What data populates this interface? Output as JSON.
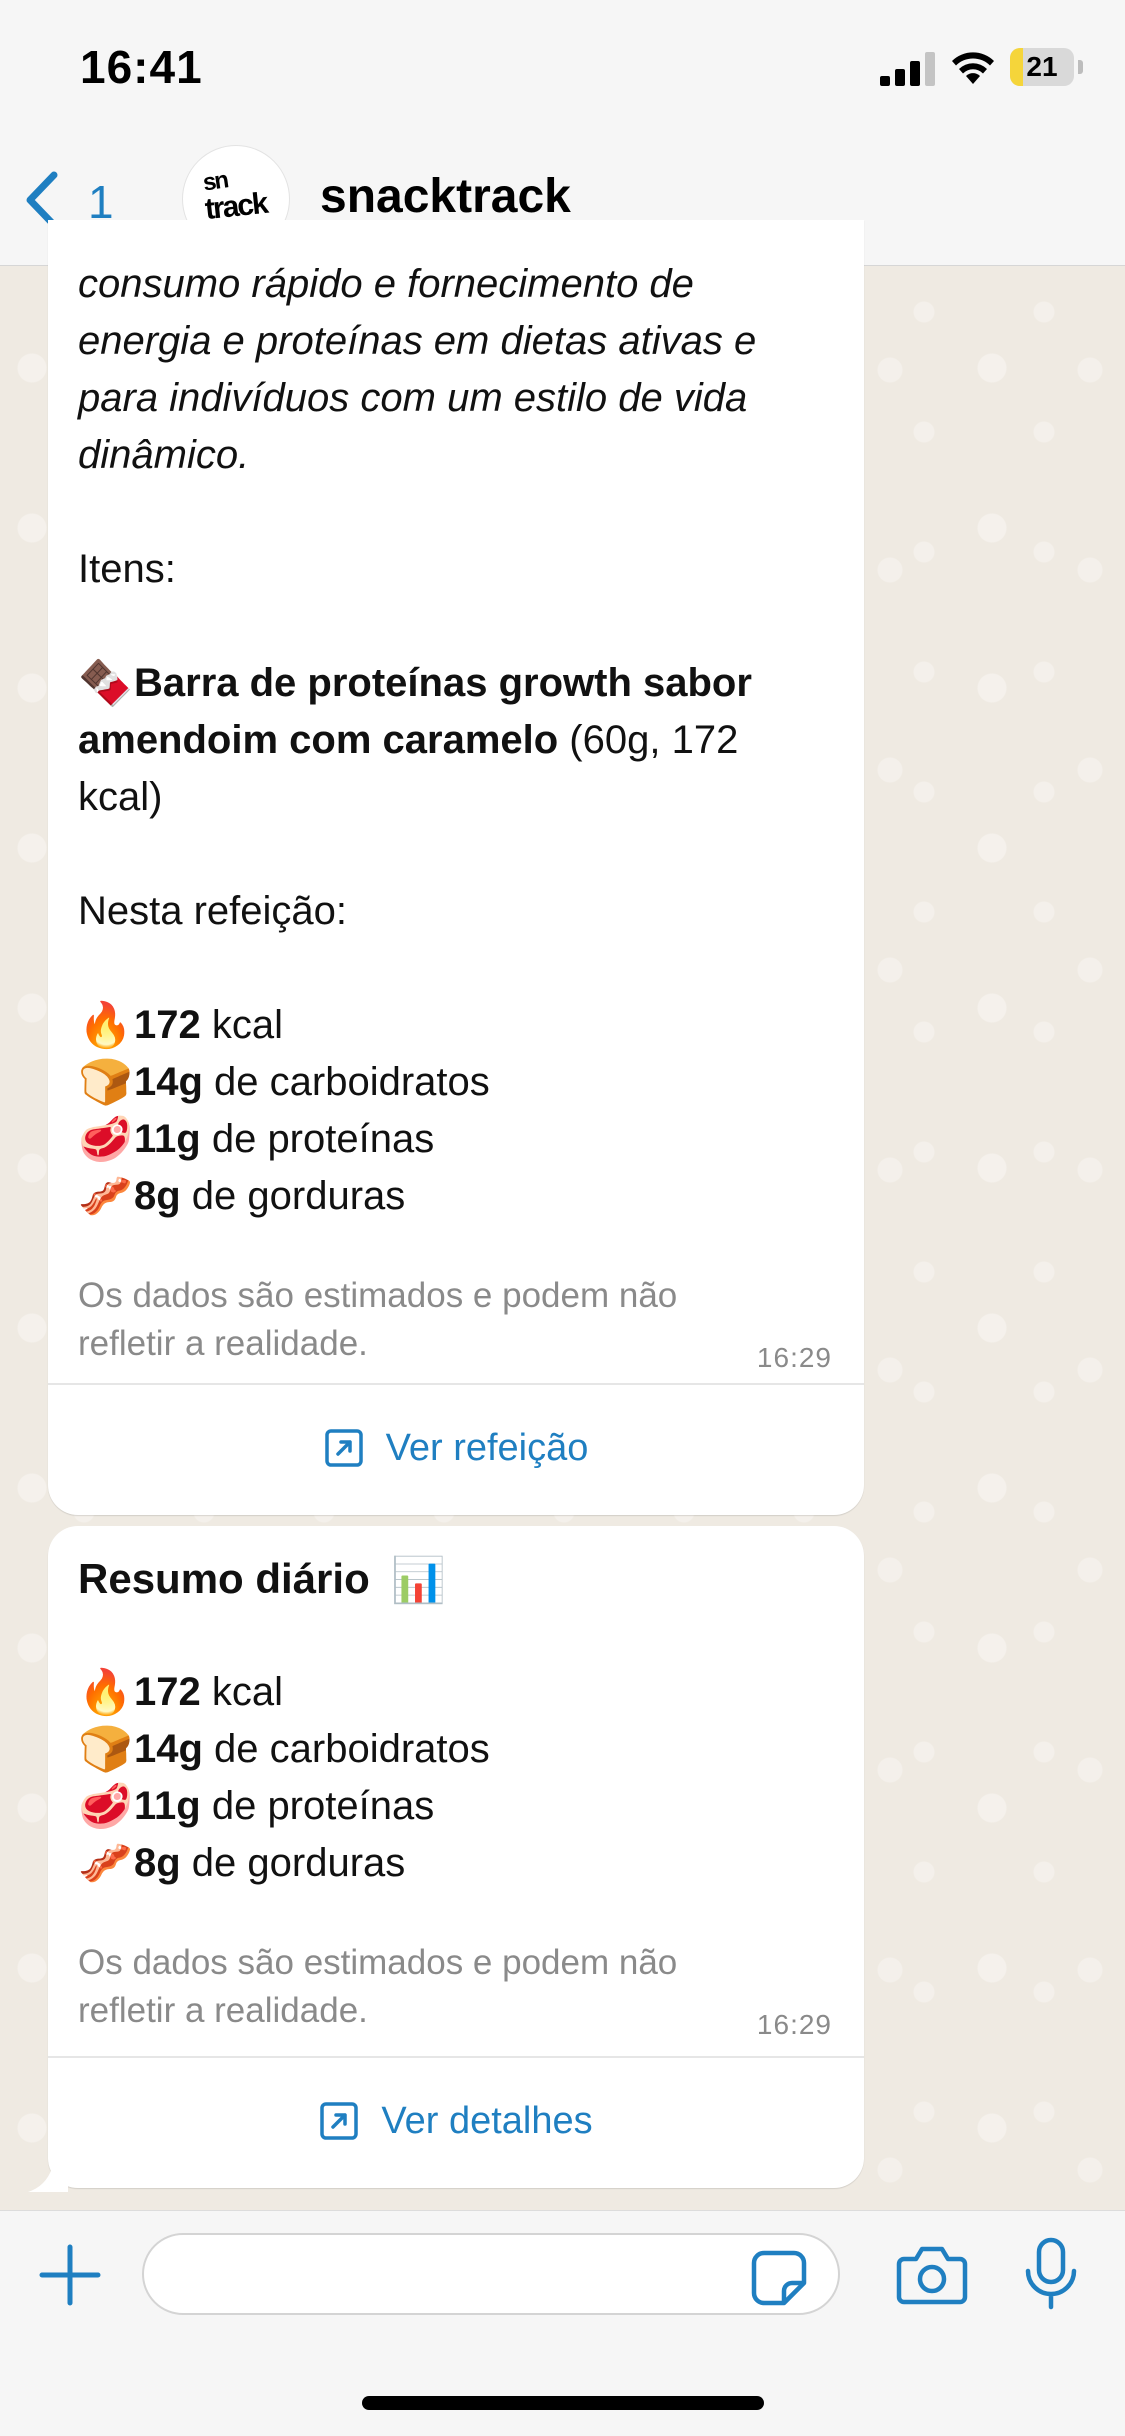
{
  "status_bar": {
    "time": "16:41",
    "battery_level": "21",
    "battery_fraction": 0.21,
    "icons": [
      "signal-icon",
      "wifi-icon",
      "battery-icon"
    ]
  },
  "header": {
    "back_count": "1",
    "avatar_logo_line1": "sn",
    "avatar_logo_line2": "track",
    "title": "snacktrack"
  },
  "colors": {
    "accent": "#1f7fc1",
    "chat_background": "#efeae2",
    "bubble": "#ffffff",
    "muted_text": "#8a8a8a"
  },
  "messages": [
    {
      "intro_lines": [
        "consumo rápido e fornecimento de",
        "energia e proteínas em dietas ativas e",
        "para indivíduos com um estilo de vida",
        "dinâmico."
      ],
      "items_heading": "Itens:",
      "item": {
        "emoji": "🍫",
        "name_line1": "Barra de proteínas growth sabor",
        "name_line2": "amendoim com caramelo",
        "detail_inline": " (60g, 172",
        "detail_wrap": "kcal)"
      },
      "meal_heading": "Nesta refeição:",
      "nutrients": [
        {
          "emoji": "🔥",
          "value": "172",
          "unit": " kcal"
        },
        {
          "emoji": "🍞",
          "value": "14g",
          "unit": " de carboidratos"
        },
        {
          "emoji": "🥩",
          "value": "11g",
          "unit": " de proteínas"
        },
        {
          "emoji": "🥓",
          "value": "8g",
          "unit": " de gorduras"
        }
      ],
      "disclaimer_line1": "Os dados são estimados e podem não",
      "disclaimer_line2": "refletir a realidade.",
      "time": "16:29",
      "action_label": "Ver refeição",
      "action_icon": "open-external-icon"
    },
    {
      "title": "Resumo diário",
      "title_emoji": "📊",
      "nutrients": [
        {
          "emoji": "🔥",
          "value": "172",
          "unit": " kcal"
        },
        {
          "emoji": "🍞",
          "value": "14g",
          "unit": " de carboidratos"
        },
        {
          "emoji": "🥩",
          "value": "11g",
          "unit": " de proteínas"
        },
        {
          "emoji": "🥓",
          "value": "8g",
          "unit": " de gorduras"
        }
      ],
      "disclaimer_line1": "Os dados são estimados e podem não",
      "disclaimer_line2": "refletir a realidade.",
      "time": "16:29",
      "action_label": "Ver detalhes",
      "action_icon": "open-external-icon"
    }
  ],
  "composer": {
    "placeholder": "",
    "icons": [
      "plus-icon",
      "sticker-icon",
      "camera-icon",
      "microphone-icon"
    ]
  }
}
